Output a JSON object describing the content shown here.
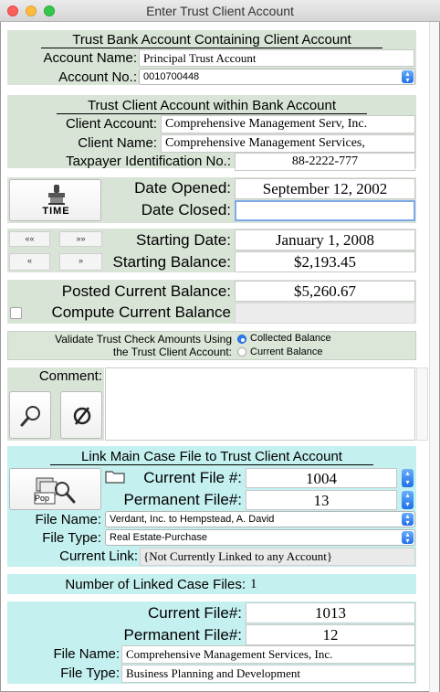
{
  "window": {
    "title": "Enter Trust Client Account"
  },
  "bank_section": {
    "header": "Trust Bank Account Containing Client Account",
    "account_name_label": "Account Name:",
    "account_name": "Principal Trust Account",
    "account_no_label": "Account No.:",
    "account_no": "0010700448"
  },
  "client_section": {
    "header": "Trust Client Account within Bank Account",
    "client_account_label": "Client Account:",
    "client_account": "Comprehensive Management Serv, Inc.",
    "client_name_label": "Client Name:",
    "client_name": "Comprehensive Management Services,",
    "taxpayer_label": "Taxpayer Identification No.:",
    "taxpayer": "88-2222-777"
  },
  "dates": {
    "time_button_label": "TIME",
    "date_opened_label": "Date Opened:",
    "date_opened": "September 12, 2002",
    "date_closed_label": "Date Closed:",
    "date_closed": ""
  },
  "starting": {
    "nav_first": "««",
    "nav_last": "»»",
    "nav_prev": "«",
    "nav_next": "»",
    "starting_date_label": "Starting Date:",
    "starting_date": "January 1, 2008",
    "starting_balance_label": "Starting Balance:",
    "starting_balance": "$2,193.45"
  },
  "current": {
    "posted_label": "Posted Current Balance:",
    "posted": "$5,260.67",
    "compute_label": "Compute Current Balance"
  },
  "validate": {
    "label_line1": "Validate Trust Check Amounts Using",
    "label_line2": "the Trust Client Account:",
    "option_collected": "Collected Balance",
    "option_current": "Current Balance"
  },
  "comment": {
    "label": "Comment:",
    "value": ""
  },
  "link_section": {
    "header": "Link Main Case File to Trust Client Account",
    "pop_label": "Pop",
    "current_file_label": "Current File #:",
    "current_file": "1004",
    "permanent_file_label": "Permanent File#:",
    "permanent_file": "13",
    "file_name_label": "File Name:",
    "file_name": "Verdant, Inc. to Hempstead, A. David",
    "file_type_label": "File Type:",
    "file_type": "Real Estate-Purchase",
    "current_link_label": "Current Link:",
    "current_link": "{Not Currently Linked to any Account}"
  },
  "linked": {
    "count_label": "Number of Linked Case Files:",
    "count": "1",
    "current_file_label": "Current File#:",
    "current_file": "1013",
    "permanent_file_label": "Permanent File#:",
    "permanent_file": "12",
    "file_name_label": "File Name:",
    "file_name": "Comprehensive Management Services, Inc.",
    "file_type_label": "File Type:",
    "file_type": "Business Planning and Development"
  },
  "colors": {
    "green_panel": "#d8e4d6",
    "cyan_panel": "#c4f0ef",
    "radio_accent": "#2d7cf6"
  }
}
